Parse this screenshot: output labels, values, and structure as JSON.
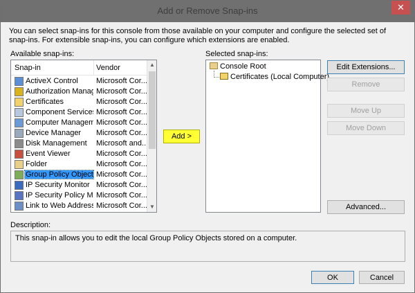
{
  "window": {
    "title": "Add or Remove Snap-ins",
    "close_glyph": "✕"
  },
  "intro_text": "You can select snap-ins for this console from those available on your computer and configure the selected set of snap-ins. For extensible snap-ins, you can configure which extensions are enabled.",
  "available": {
    "label": "Available snap-ins:",
    "columns": {
      "snapin": "Snap-in",
      "vendor": "Vendor"
    },
    "rows": [
      {
        "name": "ActiveX Control",
        "vendor": "Microsoft Cor...",
        "icon": "activex-icon"
      },
      {
        "name": "Authorization Manager",
        "vendor": "Microsoft Cor...",
        "icon": "authorization-icon"
      },
      {
        "name": "Certificates",
        "vendor": "Microsoft Cor...",
        "icon": "certificate-icon"
      },
      {
        "name": "Component Services",
        "vendor": "Microsoft Cor...",
        "icon": "component-icon"
      },
      {
        "name": "Computer Managem...",
        "vendor": "Microsoft Cor...",
        "icon": "computer-icon"
      },
      {
        "name": "Device Manager",
        "vendor": "Microsoft Cor...",
        "icon": "device-icon"
      },
      {
        "name": "Disk Management",
        "vendor": "Microsoft and...",
        "icon": "disk-icon"
      },
      {
        "name": "Event Viewer",
        "vendor": "Microsoft Cor...",
        "icon": "event-icon"
      },
      {
        "name": "Folder",
        "vendor": "Microsoft Cor...",
        "icon": "folder-icon"
      },
      {
        "name": "Group Policy Object ...",
        "vendor": "Microsoft Cor...",
        "icon": "policy-icon",
        "selected": true
      },
      {
        "name": "IP Security Monitor",
        "vendor": "Microsoft Cor...",
        "icon": "ipsec-icon"
      },
      {
        "name": "IP Security Policy M...",
        "vendor": "Microsoft Cor...",
        "icon": "ipsec-policy-icon"
      },
      {
        "name": "Link to Web Address",
        "vendor": "Microsoft Cor...",
        "icon": "link-icon"
      }
    ]
  },
  "add_button": "Add >",
  "selected": {
    "label": "Selected snap-ins:",
    "root": "Console Root",
    "child": "Certificates (Local Computer)"
  },
  "buttons": {
    "edit_extensions": "Edit Extensions...",
    "remove": "Remove",
    "move_up": "Move Up",
    "move_down": "Move Down",
    "advanced": "Advanced...",
    "ok": "OK",
    "cancel": "Cancel"
  },
  "description": {
    "label": "Description:",
    "text": "This snap-in allows you to edit the local Group Policy Objects stored on a computer."
  },
  "colors": {
    "add_highlight": "#ffff33",
    "selection": "#3399ff",
    "title_bar": "#707070"
  }
}
